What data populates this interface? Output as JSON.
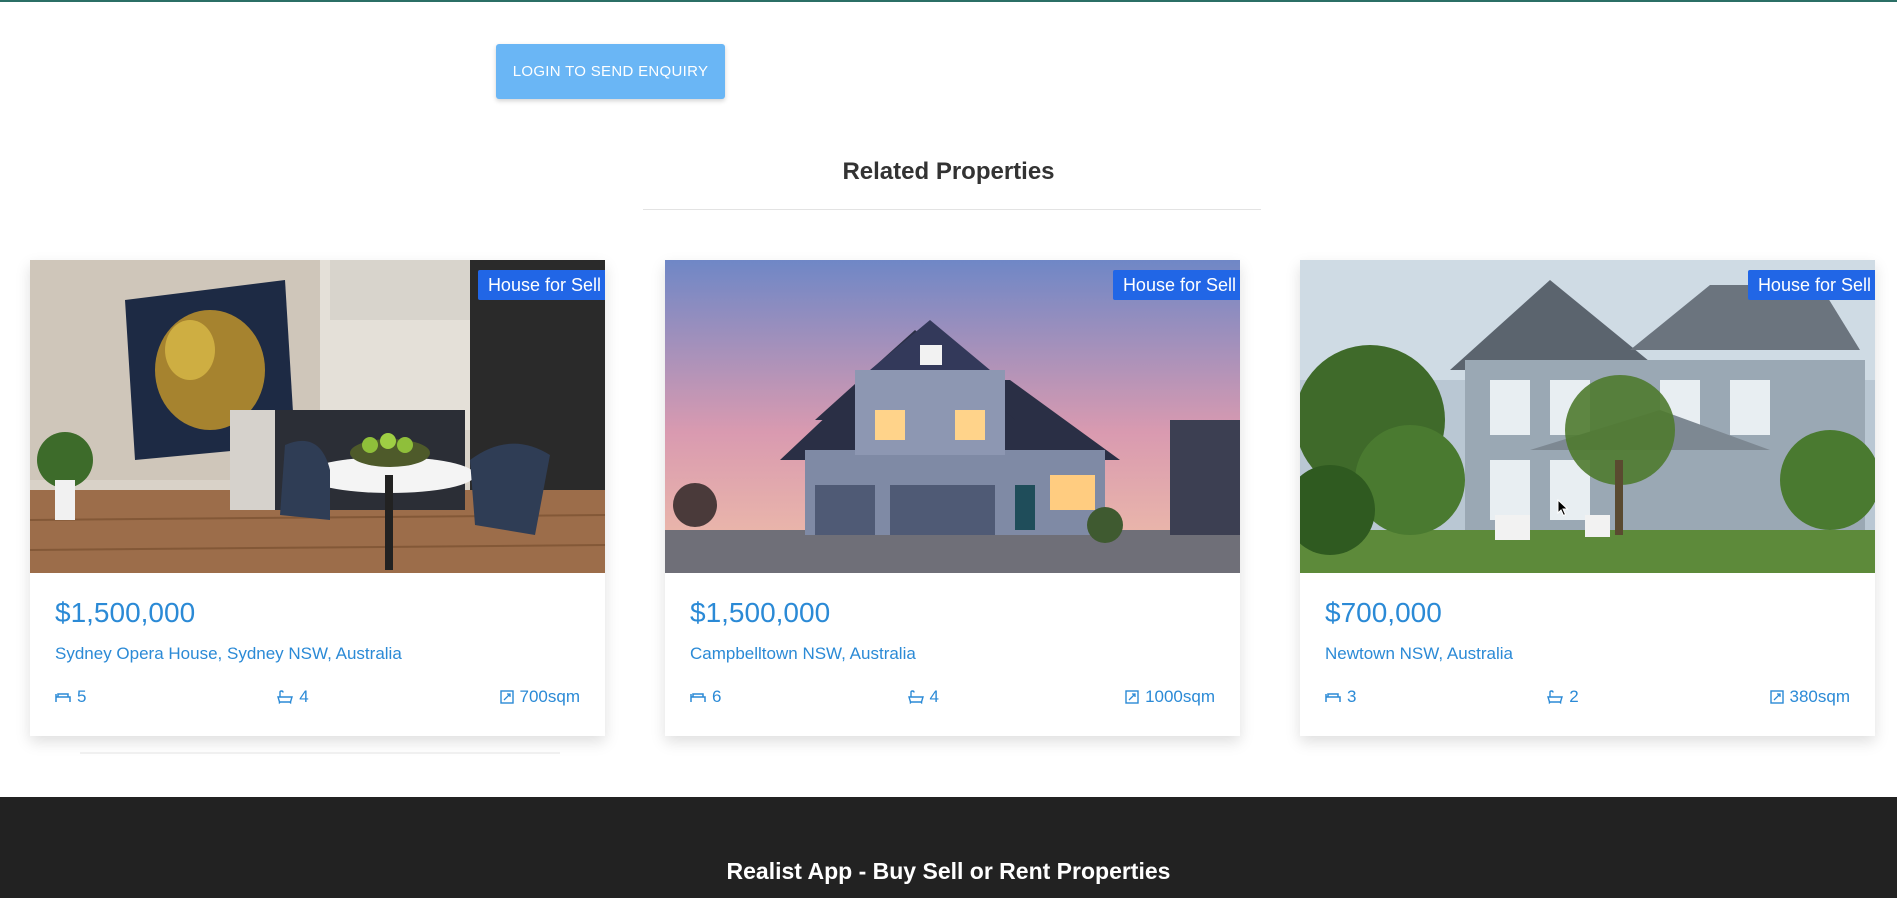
{
  "enquiry": {
    "button_label": "LOGIN TO SEND ENQUIRY"
  },
  "related": {
    "title": "Related Properties",
    "cards": [
      {
        "badge": "House for Sell",
        "price": "$1,500,000",
        "address": "Sydney Opera House, Sydney NSW, Australia",
        "bedrooms": "5",
        "bathrooms": "4",
        "area": "700sqm",
        "image": "kitchen-interior"
      },
      {
        "badge": "House for Sell",
        "price": "$1,500,000",
        "address": "Campbelltown NSW, Australia",
        "bedrooms": "6",
        "bathrooms": "4",
        "area": "1000sqm",
        "image": "house-at-dusk"
      },
      {
        "badge": "House for Sell",
        "price": "$700,000",
        "address": "Newtown NSW, Australia",
        "bedrooms": "3",
        "bathrooms": "2",
        "area": "380sqm",
        "image": "grey-house-garden"
      }
    ]
  },
  "icons": {
    "bedroom": "bed-icon",
    "bathroom": "bathtub-icon",
    "area": "area-icon"
  },
  "footer": {
    "title": "Realist App - Buy Sell or Rent Properties"
  },
  "colors": {
    "accent": "#2b8ad6",
    "badge": "#2166e6",
    "button": "#6ab6f5",
    "footer": "#222222"
  }
}
